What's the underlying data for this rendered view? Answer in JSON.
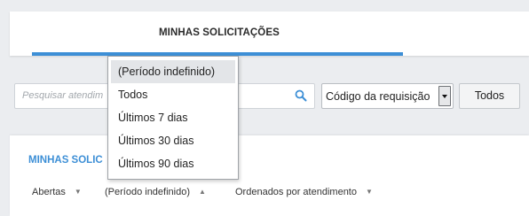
{
  "tabs": {
    "active_label": "MINHAS SOLICITAÇÕES"
  },
  "toolbar": {
    "search_placeholder": "Pesquisar atendim",
    "sort_field_value": "Código da requisição",
    "todos_button_label": "Todos"
  },
  "list": {
    "title": "MINHAS SOLIC",
    "filters": {
      "status": "Abertas",
      "period": "(Período indefinido)",
      "order": "Ordenados por atendimento"
    }
  },
  "period_dropdown": {
    "options": [
      "(Período indefinido)",
      "Todos",
      "Últimos 7 dias",
      "Últimos 30 dias",
      "Últimos 90 dias"
    ],
    "selected_index": 0
  },
  "colors": {
    "accent": "#3d8fd6",
    "background": "#ebedf0"
  },
  "icons": {
    "search": "search-icon",
    "select_arrow": "chevron-down-icon",
    "sort_desc": "caret-down-icon",
    "sort_asc": "caret-up-icon"
  }
}
